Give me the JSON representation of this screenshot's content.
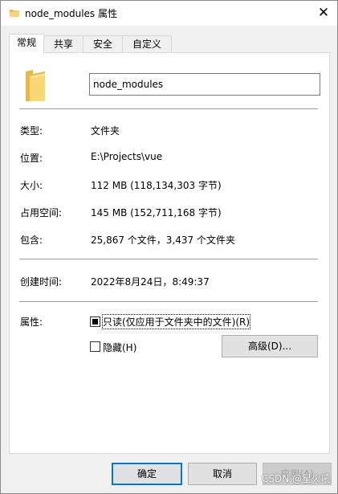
{
  "window": {
    "title": "node_modules 属性",
    "close_glyph": "✕"
  },
  "tabs": [
    {
      "label": "常规",
      "active": true
    },
    {
      "label": "共享",
      "active": false
    },
    {
      "label": "安全",
      "active": false
    },
    {
      "label": "自定义",
      "active": false
    }
  ],
  "general": {
    "name_value": "node_modules",
    "type_label": "类型:",
    "type_value": "文件夹",
    "location_label": "位置:",
    "location_value": "E:\\Projects\\vue",
    "size_label": "大小:",
    "size_value": "112 MB (118,134,303 字节)",
    "disk_size_label": "占用空间:",
    "disk_size_value": "145 MB (152,711,168 字节)",
    "contains_label": "包含:",
    "contains_value": "25,867 个文件，3,437 个文件夹",
    "created_label": "创建时间:",
    "created_value": "2022年8月24日，8:49:37",
    "attributes_label": "属性:",
    "readonly_label": "只读(仅应用于文件夹中的文件)(R)",
    "readonly_state": "indeterminate",
    "hidden_label": "隐藏(H)",
    "hidden_state": "unchecked",
    "advanced_button": "高级(D)..."
  },
  "footer": {
    "ok_button": "确定",
    "cancel_button": "取消",
    "apply_button": "应用(A)"
  },
  "watermark": "CSDN @星火吼",
  "colors": {
    "folder_yellow": "#f8d775",
    "folder_dark": "#e9b840",
    "accent": "#0078d7"
  }
}
